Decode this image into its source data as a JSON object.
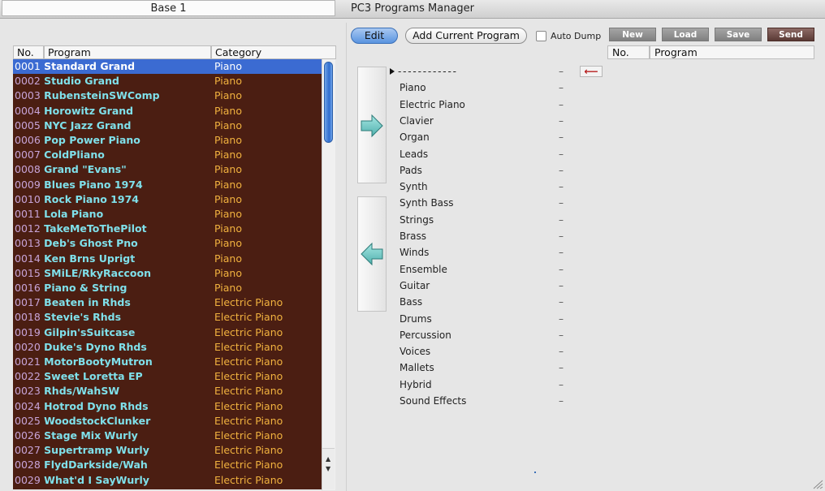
{
  "window": {
    "title": "PC3 Programs Manager"
  },
  "left": {
    "header": "Base 1",
    "columns": {
      "no": "No.",
      "program": "Program",
      "category": "Category"
    },
    "rows": [
      {
        "no": "0001",
        "name": "Standard Grand",
        "cat": "Piano",
        "selected": true
      },
      {
        "no": "0002",
        "name": "Studio Grand",
        "cat": "Piano"
      },
      {
        "no": "0003",
        "name": "RubensteinSWComp",
        "cat": "Piano"
      },
      {
        "no": "0004",
        "name": "Horowitz Grand",
        "cat": "Piano"
      },
      {
        "no": "0005",
        "name": "NYC Jazz Grand",
        "cat": "Piano"
      },
      {
        "no": "0006",
        "name": "Pop Power Piano",
        "cat": "Piano"
      },
      {
        "no": "0007",
        "name": "ColdPliano",
        "cat": "Piano"
      },
      {
        "no": "0008",
        "name": "Grand  \"Evans\"",
        "cat": "Piano"
      },
      {
        "no": "0009",
        "name": "Blues Piano 1974",
        "cat": "Piano"
      },
      {
        "no": "0010",
        "name": "Rock Piano 1974",
        "cat": "Piano"
      },
      {
        "no": "0011",
        "name": "Lola Piano",
        "cat": "Piano"
      },
      {
        "no": "0012",
        "name": "TakeMeToThePilot",
        "cat": "Piano"
      },
      {
        "no": "0013",
        "name": "Deb's  Ghost Pno",
        "cat": "Piano"
      },
      {
        "no": "0014",
        "name": "Ken Brns Uprigt",
        "cat": "Piano"
      },
      {
        "no": "0015",
        "name": "SMiLE/RkyRaccoon",
        "cat": "Piano"
      },
      {
        "no": "0016",
        "name": "Piano & String",
        "cat": "Piano"
      },
      {
        "no": "0017",
        "name": "Beaten in Rhds",
        "cat": "Electric Piano"
      },
      {
        "no": "0018",
        "name": "Stevie's Rhds",
        "cat": "Electric Piano"
      },
      {
        "no": "0019",
        "name": "Gilpin'sSuitcase",
        "cat": "Electric Piano"
      },
      {
        "no": "0020",
        "name": "Duke's Dyno Rhds",
        "cat": "Electric Piano"
      },
      {
        "no": "0021",
        "name": "MotorBootyMutron",
        "cat": "Electric Piano"
      },
      {
        "no": "0022",
        "name": "Sweet Loretta EP",
        "cat": "Electric Piano"
      },
      {
        "no": "0023",
        "name": "Rhds/WahSW",
        "cat": "Electric Piano"
      },
      {
        "no": "0024",
        "name": "Hotrod Dyno Rhds",
        "cat": "Electric Piano"
      },
      {
        "no": "0025",
        "name": "WoodstockClunker",
        "cat": "Electric Piano"
      },
      {
        "no": "0026",
        "name": "Stage Mix Wurly",
        "cat": "Electric Piano"
      },
      {
        "no": "0027",
        "name": "Supertramp Wurly",
        "cat": "Electric Piano"
      },
      {
        "no": "0028",
        "name": "FlydDarkside/Wah",
        "cat": "Electric Piano"
      },
      {
        "no": "0029",
        "name": "What'd I SayWurly",
        "cat": "Electric Piano"
      }
    ]
  },
  "toolbar": {
    "edit": "Edit",
    "add_current": "Add Current Program",
    "auto_dump": "Auto Dump",
    "auto_dump_checked": false
  },
  "categories": {
    "first": "- - - - - - - - - - - -",
    "dash": "–",
    "items": [
      "Piano",
      "Electric Piano",
      "Clavier",
      "Organ",
      "Leads",
      "Pads",
      "Synth",
      "Synth Bass",
      "Strings",
      "Brass",
      "Winds",
      "Ensemble",
      "Guitar",
      "Bass",
      "Drums",
      "Percussion",
      "Voices",
      "Mallets",
      "Hybrid",
      "Sound Effects"
    ],
    "remove_arrow": "⟵"
  },
  "right": {
    "buttons": {
      "new": "New",
      "load": "Load",
      "save": "Save",
      "send": "Send"
    },
    "columns": {
      "no": "No.",
      "program": "Program"
    }
  },
  "colors": {
    "list_bg": "#4b1e12",
    "program_text": "#7fe0ea",
    "category_text": "#f1b23f",
    "number_text": "#c7a4d8",
    "selection": "#3b6bd2",
    "arrow_teal": "#6cc9c6"
  }
}
